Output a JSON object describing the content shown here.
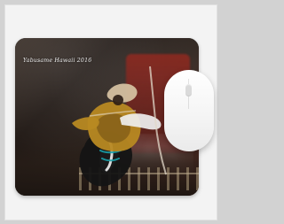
{
  "mousepad": {
    "caption": "Yabusame Hawaii 2016"
  }
}
